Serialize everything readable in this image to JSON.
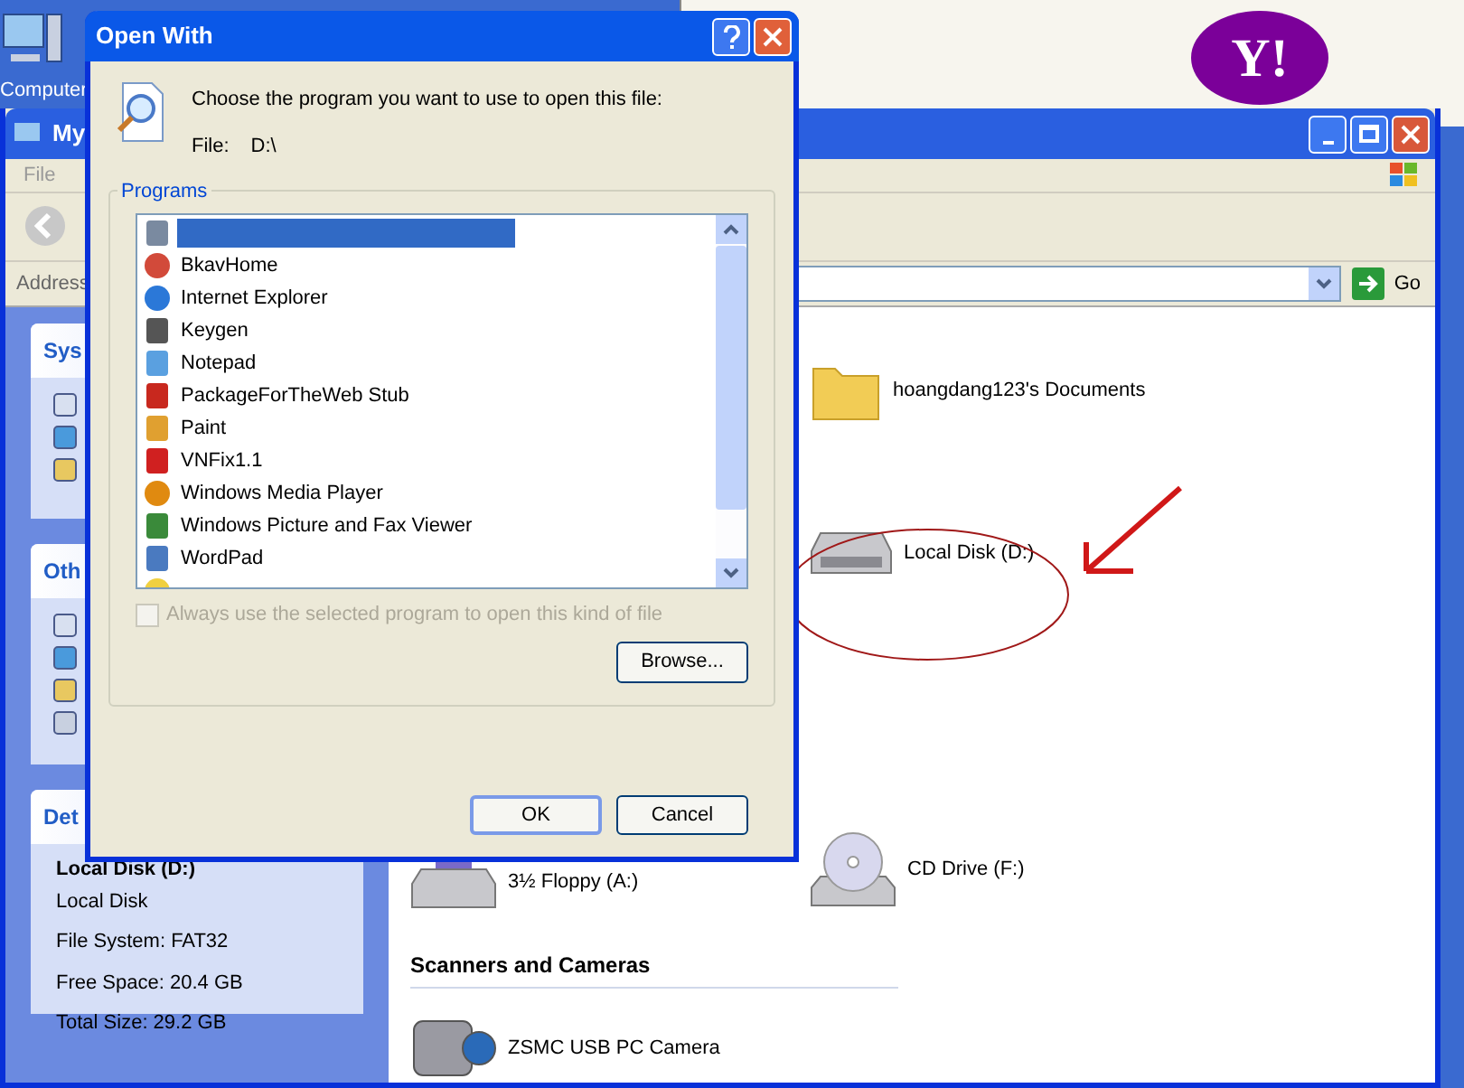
{
  "desktop": {
    "icon_label": "Computer"
  },
  "background_window": {
    "logo": "Y!"
  },
  "explorer": {
    "title": "My",
    "menu": [
      "File"
    ],
    "address_label": "Address",
    "go": "Go",
    "panels": [
      {
        "title": "Sys",
        "kind": "tasks"
      },
      {
        "title": "Oth",
        "kind": "places"
      },
      {
        "title": "Det",
        "kind": "details",
        "name": "Local Disk (D:)",
        "lines": [
          "Local Disk",
          "File System: FAT32",
          "Free Space: 20.4 GB",
          "Total Size: 29.2 GB"
        ]
      }
    ],
    "items": [
      {
        "label": "hoangdang123's Documents",
        "kind": "folder"
      },
      {
        "label": "Local Disk (D:)",
        "kind": "disk"
      },
      {
        "label": "3½ Floppy (A:)",
        "kind": "floppy"
      },
      {
        "label": "CD Drive (F:)",
        "kind": "cd"
      }
    ],
    "section": "Scanners and Cameras",
    "devices": [
      {
        "label": "ZSMC USB PC Camera",
        "kind": "camera"
      }
    ]
  },
  "dialog": {
    "title": "Open With",
    "prompt": "Choose the program you want to use to open this file:",
    "file_label": "File:",
    "file_value": "D:\\",
    "group_label": "Programs",
    "programs": [
      {
        "selected": true,
        "kind": "disk"
      },
      {
        "label": "BkavHome",
        "selected": false,
        "kind": "bkav"
      },
      {
        "label": "Internet Explorer",
        "selected": false,
        "kind": "ie"
      },
      {
        "label": "Keygen",
        "selected": false,
        "kind": "keygen"
      },
      {
        "label": "Notepad",
        "selected": false,
        "kind": "notepad"
      },
      {
        "label": "PackageForTheWeb Stub",
        "selected": false,
        "kind": "package"
      },
      {
        "label": "Paint",
        "selected": false,
        "kind": "paint"
      },
      {
        "label": "VNFix1.1",
        "selected": false,
        "kind": "vnfix"
      },
      {
        "label": "Windows Media Player",
        "selected": false,
        "kind": "wmp"
      },
      {
        "label": "Windows Picture and Fax Viewer",
        "selected": false,
        "kind": "picture"
      },
      {
        "label": "WordPad",
        "selected": false,
        "kind": "wordpad"
      },
      {
        "selected": false,
        "kind": "smiley"
      }
    ],
    "always_use": {
      "label": "Always use the selected program to open this kind of file",
      "checked": false,
      "disabled": true
    },
    "browse": "Browse...",
    "ok": "OK",
    "cancel": "Cancel"
  }
}
